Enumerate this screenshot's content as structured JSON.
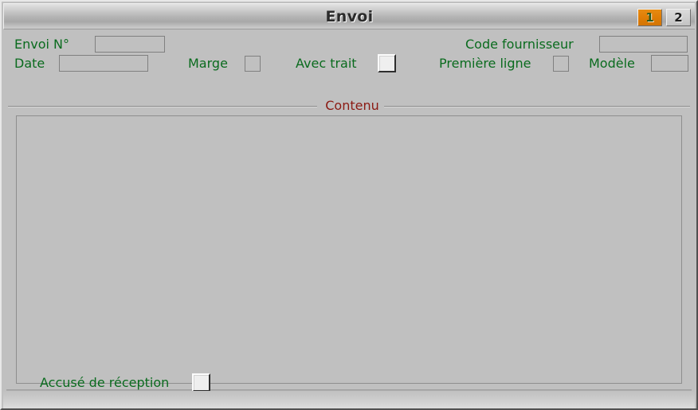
{
  "window": {
    "title": "Envoi",
    "accent_orange": "#df7d06",
    "label_green": "#0a6b1e",
    "legend_red": "#8b1a13",
    "face_gray": "#c0c0c0"
  },
  "pager": {
    "pages": [
      {
        "label": "1",
        "state": "active"
      },
      {
        "label": "2",
        "state": "inactive"
      }
    ]
  },
  "form": {
    "envoi_num": {
      "label": "Envoi N°",
      "value": "",
      "placeholder": ""
    },
    "date": {
      "label": "Date",
      "value": "",
      "placeholder": ""
    },
    "marge": {
      "label": "Marge",
      "value": "",
      "checked": false
    },
    "avec_trait": {
      "label": "Avec trait",
      "checked": false,
      "focused": true
    },
    "code_fournisseur": {
      "label": "Code fournisseur",
      "value": "",
      "placeholder": ""
    },
    "premiere_ligne": {
      "label": "Première ligne",
      "value": "",
      "checked": false
    },
    "modele": {
      "label": "Modèle",
      "value": "",
      "placeholder": ""
    }
  },
  "contenu": {
    "legend": "Contenu",
    "text": ""
  },
  "footer": {
    "accuse_reception": {
      "label": "Accusé de réception",
      "checked": false
    }
  }
}
